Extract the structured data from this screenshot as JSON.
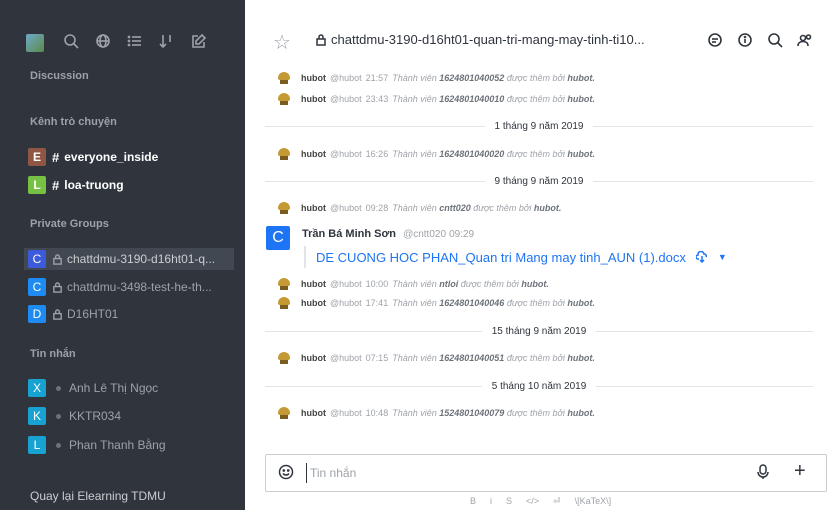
{
  "sidebar": {
    "sections": {
      "discussion": "Discussion",
      "channels": "Kênh trò chuyện",
      "private": "Private Groups",
      "messages": "Tin nhắn"
    },
    "channels": [
      {
        "initial": "E",
        "color": "#8e5643",
        "name": "everyone_inside"
      },
      {
        "initial": "L",
        "color": "#76c043",
        "name": "loa-truong"
      }
    ],
    "groups": [
      {
        "initial": "C",
        "color": "#3b5bdb",
        "name": "chattdmu-3190-d16ht01-q..."
      },
      {
        "initial": "C",
        "color": "#1d8bf1",
        "name": "chattdmu-3498-test-he-th..."
      },
      {
        "initial": "D",
        "color": "#1d8bf1",
        "name": "D16HT01"
      }
    ],
    "directs": [
      {
        "initial": "X",
        "color": "#17a2d2",
        "name": "Anh Lê Thị Ngọc"
      },
      {
        "initial": "K",
        "color": "#17a2d2",
        "name": "KKTR034"
      },
      {
        "initial": "L",
        "color": "#17a2d2",
        "name": "Phan Thanh Bằng"
      }
    ],
    "footer": "Quay lại Elearning TDMU"
  },
  "header": {
    "title": "chattdmu-3190-d16ht01-quan-tri-mang-may-tinh-ti10..."
  },
  "messages": [
    {
      "user": "hubot",
      "handle": "@hubot",
      "time": "21:57",
      "text": "Thành viên ",
      "member": "1624801040052",
      "after": " được thêm bởi ",
      "by": "hubot."
    },
    {
      "user": "hubot",
      "handle": "@hubot",
      "time": "23:43",
      "text": "Thành viên ",
      "member": "1624801040010",
      "after": " được thêm bởi ",
      "by": "hubot."
    },
    {
      "user": "hubot",
      "handle": "@hubot",
      "time": "16:26",
      "text": "Thành viên ",
      "member": "1624801040020",
      "after": " được thêm bởi ",
      "by": "hubot."
    },
    {
      "user": "hubot",
      "handle": "@hubot",
      "time": "09:28",
      "text": "Thành viên ",
      "member": "cntt020",
      "after": " được thêm bởi ",
      "by": "hubot."
    },
    {
      "user": "hubot",
      "handle": "@hubot",
      "time": "10:00",
      "text": "Thành viên ",
      "member": "ntloi",
      "after": " được thêm bởi ",
      "by": "hubot."
    },
    {
      "user": "hubot",
      "handle": "@hubot",
      "time": "17:41",
      "text": "Thành viên ",
      "member": "1624801040046",
      "after": " được thêm bởi ",
      "by": "hubot."
    },
    {
      "user": "hubot",
      "handle": "@hubot",
      "time": "07:15",
      "text": "Thành viên ",
      "member": "1624801040051",
      "after": " được thêm bởi ",
      "by": "hubot."
    },
    {
      "user": "hubot",
      "handle": "@hubot",
      "time": "10:48",
      "text": "Thành viên ",
      "member": "1524801040079",
      "after": " được thêm bởi ",
      "by": "hubot."
    }
  ],
  "dividers": [
    "1 tháng 9 năm 2019",
    "9 tháng 9 năm 2019",
    "15 tháng 9 năm 2019",
    "5 tháng 10 năm 2019"
  ],
  "user_message": {
    "initial": "C",
    "name": "Trần Bá Minh Sơn",
    "handle": "@cntt020",
    "time": "09:29",
    "attachment": "DE CUONG HOC PHAN_Quan tri Mang may tinh_AUN (1).docx"
  },
  "composer": {
    "placeholder": "Tin nhắn",
    "format": [
      "B",
      "i",
      "S",
      "</>",
      "⏎",
      "\\[KaTeX\\]"
    ]
  }
}
